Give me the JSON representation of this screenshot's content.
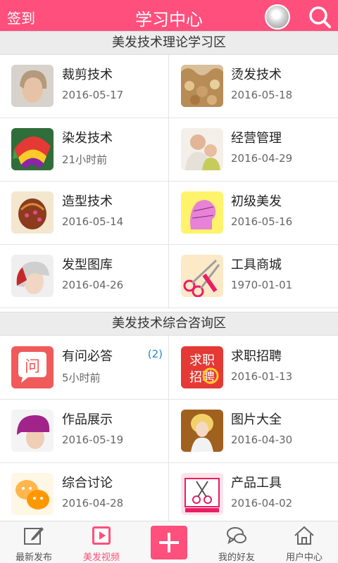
{
  "header": {
    "signin": "签到",
    "title": "学习中心"
  },
  "sections": [
    {
      "title": "美发技术理论学习区",
      "items": [
        {
          "name": "裁剪技术",
          "date": "2016-05-17"
        },
        {
          "name": "烫发技术",
          "date": "2016-05-18"
        },
        {
          "name": "染发技术",
          "date": "21小时前"
        },
        {
          "name": "经营管理",
          "date": "2016-04-29"
        },
        {
          "name": "造型技术",
          "date": "2016-05-14"
        },
        {
          "name": "初级美发",
          "date": "2016-05-16"
        },
        {
          "name": "发型图库",
          "date": "2016-04-26"
        },
        {
          "name": "工具商城",
          "date": "1970-01-01"
        }
      ]
    },
    {
      "title": "美发技术综合咨询区",
      "items": [
        {
          "name": "有问必答",
          "date": "5小时前",
          "badge": "(2)"
        },
        {
          "name": "求职招聘",
          "date": "2016-01-13",
          "thumb_text": [
            "求职",
            "招聘"
          ]
        },
        {
          "name": "作品展示",
          "date": "2016-05-19"
        },
        {
          "name": "图片大全",
          "date": "2016-04-30"
        },
        {
          "name": "综合讨论",
          "date": "2016-04-28"
        },
        {
          "name": "产品工具",
          "date": "2016-04-02"
        }
      ]
    }
  ],
  "bottom_nav": [
    {
      "label": "最新发布",
      "icon": "edit-icon"
    },
    {
      "label": "美发视频",
      "icon": "video-icon",
      "active": true
    },
    {
      "label": "",
      "icon": "plus-icon"
    },
    {
      "label": "我的好友",
      "icon": "chat-icon"
    },
    {
      "label": "用户中心",
      "icon": "home-icon"
    }
  ],
  "colors": {
    "accent": "#ff4f7c",
    "badge": "#2a86c8"
  }
}
